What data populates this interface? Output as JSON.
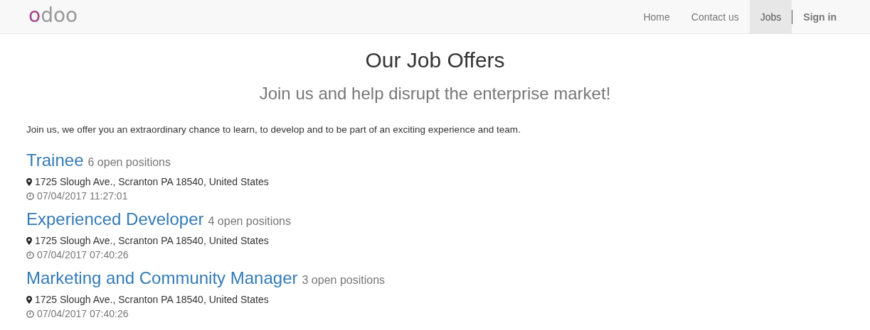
{
  "navbar": {
    "logo": "odoo",
    "items": [
      {
        "label": "Home",
        "selected": false
      },
      {
        "label": "Contact us",
        "selected": false
      },
      {
        "label": "Jobs",
        "selected": true
      }
    ],
    "sign_in": "Sign in"
  },
  "title": "Our Job Offers",
  "subtitle": "Join us and help disrupt the enterprise market!",
  "intro": "Join us, we offer you an extraordinary chance to learn, to develop and to be part of an exciting experience and team.",
  "jobs": [
    {
      "title": "Trainee",
      "positions": "6 open positions",
      "address": "1725 Slough Ave., Scranton PA 18540, United States",
      "date": "07/04/2017 11:27:01"
    },
    {
      "title": "Experienced Developer",
      "positions": "4 open positions",
      "address": "1725 Slough Ave., Scranton PA 18540, United States",
      "date": "07/04/2017 07:40:26"
    },
    {
      "title": "Marketing and Community Manager",
      "positions": "3 open positions",
      "address": "1725 Slough Ave., Scranton PA 18540, United States",
      "date": "07/04/2017 07:40:26"
    }
  ]
}
